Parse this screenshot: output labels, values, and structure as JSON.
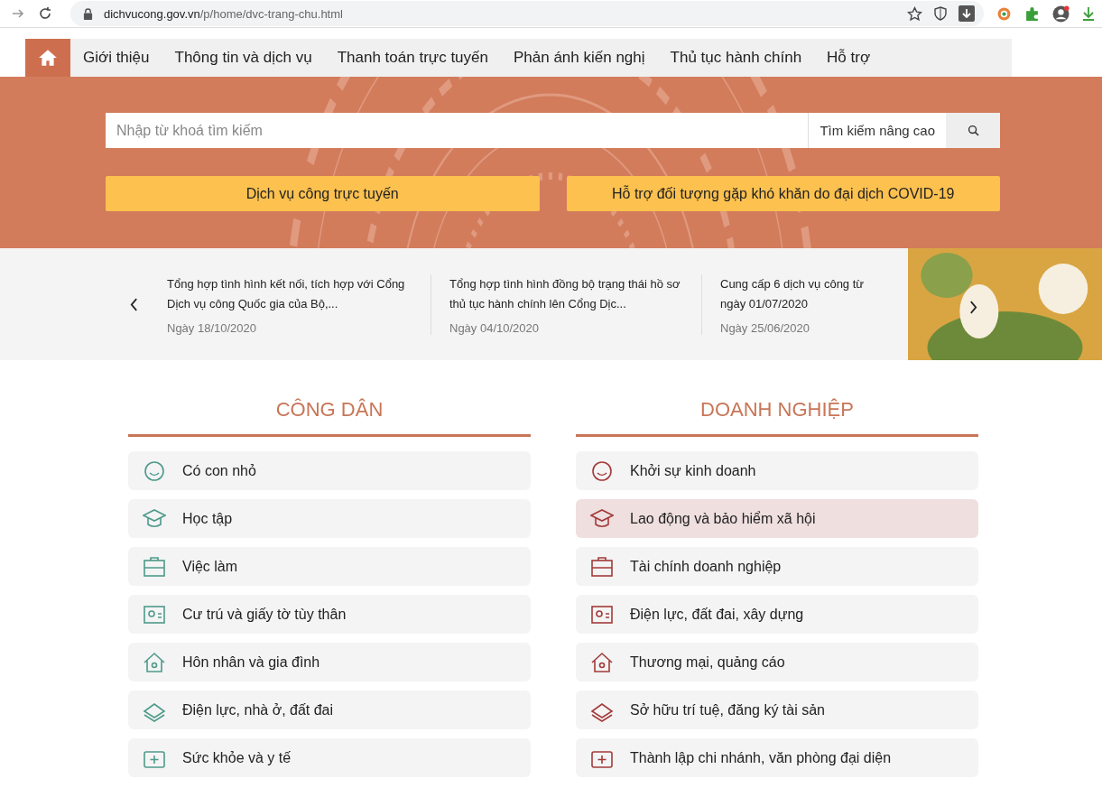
{
  "browser": {
    "url_host": "dichvucong.gov.vn",
    "url_path": "/p/home/dvc-trang-chu.html"
  },
  "nav": {
    "items": [
      {
        "label": "Giới thiệu",
        "selected": false
      },
      {
        "label": "Thông tin và dịch vụ",
        "selected": false
      },
      {
        "label": "Thanh toán trực tuyến",
        "selected": false
      },
      {
        "label": "Phản ánh kiến nghị",
        "selected": false
      },
      {
        "label": "Thủ tục hành chính",
        "selected": false
      },
      {
        "label": "Hỗ trợ",
        "selected": false
      }
    ]
  },
  "search": {
    "placeholder": "Nhập từ khoá tìm kiếm",
    "advanced": "Tìm kiếm nâng cao"
  },
  "hero_buttons": [
    "Dịch vụ công trực tuyến",
    "Hỗ trợ đối tượng gặp khó khăn do đại dịch COVID-19"
  ],
  "news": [
    {
      "title": "Tổng hợp tình hình kết nối, tích hợp với Cổng Dịch vụ công Quốc gia của Bộ,...",
      "date": "Ngày 18/10/2020"
    },
    {
      "title": "Tổng hợp tình hình đồng bộ trạng thái hồ sơ thủ tục hành chính lên Cổng Dịc...",
      "date": "Ngày 04/10/2020"
    },
    {
      "title": "Cung cấp 6 dịch vụ công từ ngày 01/07/2020",
      "date": "Ngày 25/06/2020"
    }
  ],
  "sections": [
    {
      "title": "CÔNG DÂN",
      "color": "#4e9a8a",
      "items": [
        {
          "label": "Có con nhỏ",
          "selected": false
        },
        {
          "label": "Học tập",
          "selected": false
        },
        {
          "label": "Việc làm",
          "selected": false
        },
        {
          "label": "Cư trú và giấy tờ tùy thân",
          "selected": false
        },
        {
          "label": "Hôn nhân và gia đình",
          "selected": false
        },
        {
          "label": "Điện lực, nhà ở, đất đai",
          "selected": false
        },
        {
          "label": "Sức khỏe và y tế",
          "selected": false
        }
      ]
    },
    {
      "title": "DOANH NGHIỆP",
      "color": "#a33a3a",
      "items": [
        {
          "label": "Khởi sự kinh doanh",
          "selected": false
        },
        {
          "label": "Lao động và bảo hiểm xã hội",
          "selected": true
        },
        {
          "label": "Tài chính doanh nghiệp",
          "selected": false
        },
        {
          "label": "Điện lực, đất đai, xây dựng",
          "selected": false
        },
        {
          "label": "Thương mại, quảng cáo",
          "selected": false
        },
        {
          "label": "Sở hữu trí tuệ, đăng ký tài sản",
          "selected": false
        },
        {
          "label": "Thành lập chi nhánh, văn phòng đại diện",
          "selected": false
        }
      ]
    }
  ]
}
